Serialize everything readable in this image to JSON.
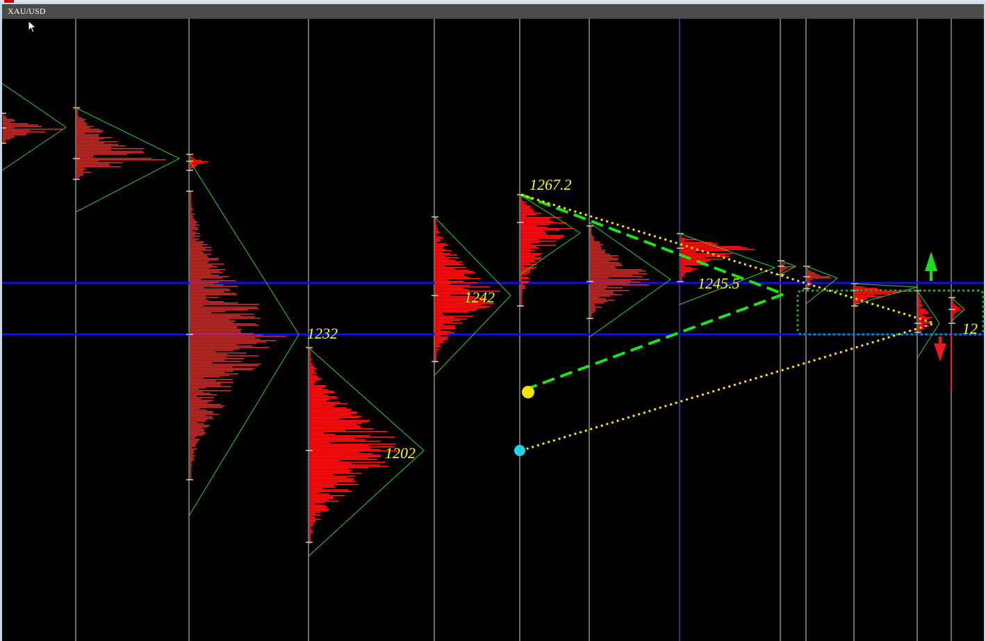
{
  "window": {
    "symbol": "XAU/USD"
  },
  "colors": {
    "background": "#000000",
    "header": "#4b4b4b",
    "session_divider": "#ffffff",
    "divider_blue": "#5f7fff",
    "profile_fill": "#ff1a1a",
    "profile_edge": "#32cd32",
    "level_line": "#1010e8",
    "label": "#ffff00",
    "trend_dashed": "#19e619",
    "trend_dotted": "#ffe600",
    "box_dotted": "#17b317",
    "arrow_up": "#1fdc1f",
    "arrow_down": "#e81c1c",
    "marker_yellow": "#f2e600",
    "marker_cyan": "#1fd6e8"
  },
  "chart_data": {
    "type": "market-profile",
    "symbol": "XAU/USD",
    "price_labels": [
      "1267.2",
      "1242",
      "1245.5",
      "1232",
      "1202",
      "12"
    ],
    "horizontal_levels": [
      "upper-level",
      "lower-level"
    ],
    "markers": [
      "marker-yellow",
      "marker-cyan"
    ],
    "arrows": [
      "arrow-up",
      "arrow-down"
    ]
  }
}
